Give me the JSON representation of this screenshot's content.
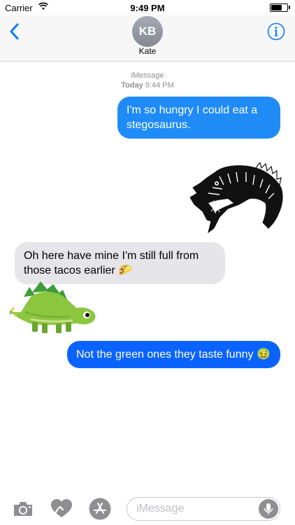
{
  "status_bar": {
    "carrier": "Carrier",
    "time": "9:49 PM",
    "battery_level": 0.7
  },
  "header": {
    "avatar_initials": "KB",
    "contact_name": "Kate",
    "back_icon": "chevron-left-icon",
    "info_icon": "info-icon"
  },
  "thread": {
    "service": "iMessage",
    "timestamp_day": "Today",
    "timestamp_time": "9:44 PM"
  },
  "messages": [
    {
      "direction": "outgoing",
      "text": "I'm so hungry I could eat a stegosaurus.",
      "color": "#1f8bf7"
    },
    {
      "direction": "outgoing",
      "sticker": "t-rex-sketch-sticker"
    },
    {
      "direction": "incoming",
      "text": "Oh here have mine I'm still full from those tacos earlier 🌮",
      "color": "#e5e5ea"
    },
    {
      "direction": "incoming",
      "sticker": "green-stegosaurus-sticker"
    },
    {
      "direction": "outgoing",
      "text": "Not the green ones they taste funny 🤢",
      "color": "#0b63ff"
    }
  ],
  "input_bar": {
    "placeholder": "iMessage",
    "value": "",
    "tools": [
      "camera-icon",
      "digital-touch-heart-icon",
      "app-store-icon"
    ],
    "mic_icon": "microphone-icon"
  },
  "colors": {
    "accent": "#0a7aff",
    "outgoing_bubble": "#1f8bf7",
    "incoming_bubble": "#e5e5ea",
    "tool_icon": "#8e8e93"
  }
}
